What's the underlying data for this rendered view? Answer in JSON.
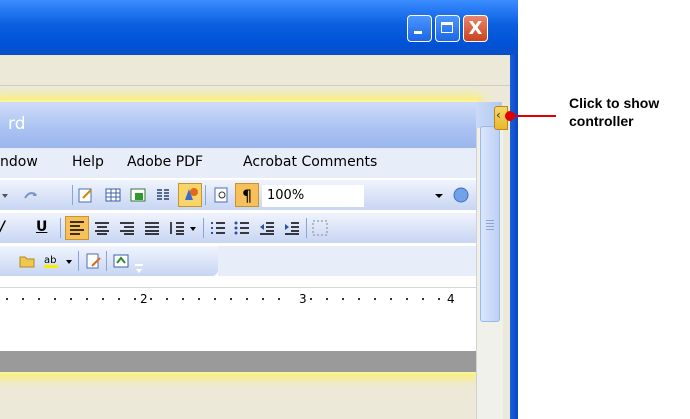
{
  "window": {
    "buttons": {
      "minimize": "minimize",
      "maximize": "maximize",
      "close": "X"
    }
  },
  "word": {
    "title_fragment": "rd",
    "menu": [
      "ndow",
      "Help",
      "Adobe PDF",
      "Acrobat Comments"
    ],
    "toolbar1": {
      "zoom": "100%"
    },
    "ruler_numbers": [
      "2",
      "3",
      "4"
    ]
  },
  "callout": {
    "text_line1": "Click to show",
    "text_line2": "controller"
  },
  "colors": {
    "accent": "#0052d6",
    "callout_line": "#e00000",
    "glow": "#fff06a"
  }
}
